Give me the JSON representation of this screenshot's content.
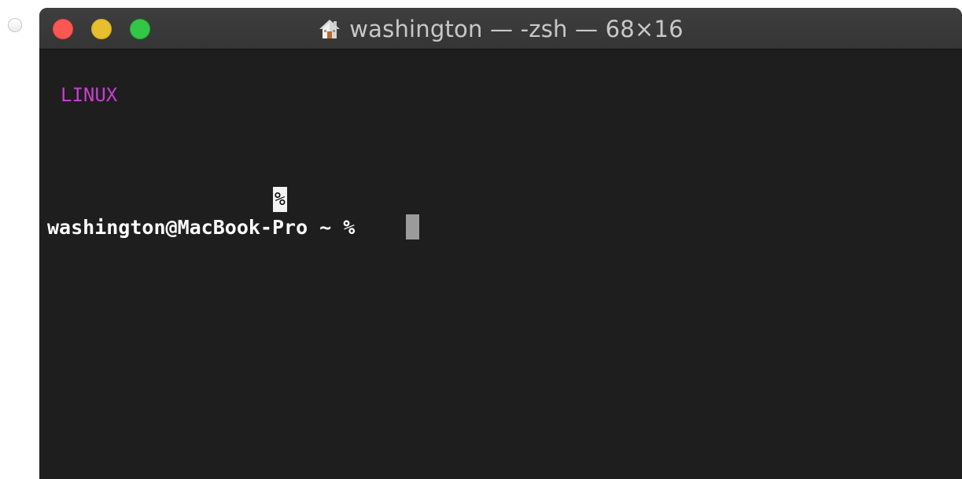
{
  "window": {
    "title": "washington — -zsh — 68×16"
  },
  "terminal": {
    "output_line": "LINUX",
    "partial_line_marker": "%",
    "prompt": "washington@MacBook-Pro ~ %"
  },
  "colors": {
    "close": "#fc5753",
    "minimize": "#e5bf2c",
    "zoom": "#33c748",
    "terminal_bg": "#1e1e1e",
    "output_text": "#c73fd1",
    "prompt_text": "#ffffff",
    "cursor": "#9b9b9b"
  },
  "icons": {
    "title_icon": "home-icon"
  }
}
